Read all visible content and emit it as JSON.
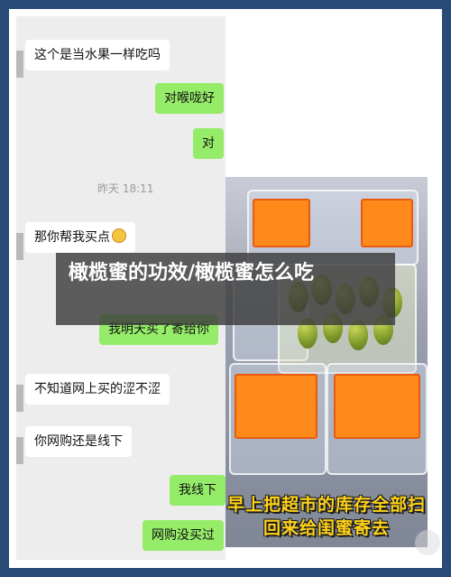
{
  "chat": {
    "messages": [
      {
        "side": "left",
        "text": "这个是当水果一样吃吗"
      },
      {
        "side": "right",
        "text": "对喉咙好"
      },
      {
        "side": "right",
        "text": "对"
      },
      {
        "side": "left",
        "text": "那你帮我买点"
      },
      {
        "side": "right",
        "text": "我明天买了寄给你"
      },
      {
        "side": "left",
        "text": "不知道网上买的涩不涩"
      },
      {
        "side": "left",
        "text": "你网购还是线下"
      },
      {
        "side": "right",
        "text": "我线下"
      },
      {
        "side": "right",
        "text": "网购没买过"
      }
    ],
    "timestamp": "昨天 18:11",
    "emoji_icon": "grinning-sweat-emoji"
  },
  "photo": {
    "caption_line1": "早上把超市的库存全部扫",
    "caption_line2": "回来给闺蜜寄去"
  },
  "overlay": {
    "title": "橄榄蜜的功效/橄榄蜜怎么吃"
  },
  "colors": {
    "background": "#2a4a78",
    "left_bubble": "#ffffff",
    "right_bubble": "#95ec69",
    "caption": "#ffd21a"
  }
}
